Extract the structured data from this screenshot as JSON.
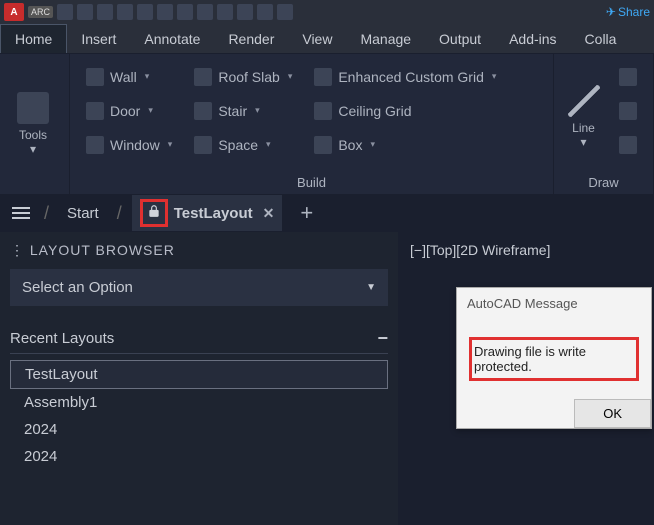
{
  "qat": {
    "logo": "A",
    "arc": "ARC",
    "share": "Share"
  },
  "ribbon_tabs": [
    "Home",
    "Insert",
    "Annotate",
    "Render",
    "View",
    "Manage",
    "Output",
    "Add-ins",
    "Colla"
  ],
  "active_tab": 0,
  "ribbon": {
    "tools_label": "Tools",
    "build_label": "Build",
    "draw_label": "Draw",
    "line_label": "Line",
    "col1": [
      "Wall",
      "Door",
      "Window"
    ],
    "col2": [
      "Roof Slab",
      "Stair",
      "Space"
    ],
    "col3": [
      "Enhanced Custom Grid",
      "Ceiling Grid",
      "Box"
    ]
  },
  "doctabs": {
    "start": "Start",
    "active": "TestLayout"
  },
  "layout_panel": {
    "title": "LAYOUT BROWSER",
    "select_placeholder": "Select an Option",
    "recent_hdr": "Recent Layouts",
    "items": [
      "TestLayout",
      "Assembly1",
      "2024",
      "2024"
    ]
  },
  "view_label": "[−][Top][2D Wireframe]",
  "dialog": {
    "title": "AutoCAD Message",
    "message": "Drawing file is write protected.",
    "ok": "OK"
  }
}
